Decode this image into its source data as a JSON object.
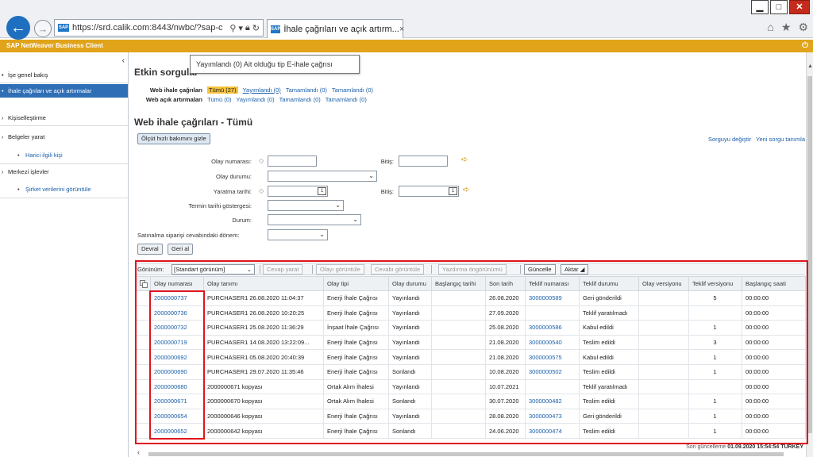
{
  "browser": {
    "url": "https://srd.calik.com:8443/nwbc/?sap-c",
    "tab_title": "İhale çağrıları ve açık artırm...",
    "tab_close": "×",
    "favicon_text": "SAP"
  },
  "sap_header": {
    "title": "SAP NetWeaver Business Client"
  },
  "sidebar": {
    "items": [
      {
        "label": "İşe genel bakış"
      },
      {
        "label": "İhale çağrıları ve açık artırmalar"
      },
      {
        "label": "Kişiselleştirme"
      },
      {
        "label": "Belgeler yarat"
      },
      {
        "label": "Harici ilgili kişi"
      },
      {
        "label": "Merkezi işlevler"
      },
      {
        "label": "Şirket verilerini görüntüle"
      }
    ]
  },
  "tooltip": "Yayımlandı (0) Ait olduğu tip E-ihale çağrısı",
  "queries": {
    "title": "Etkin sorgular",
    "web_ihale": {
      "label": "Web ihale çağrıları",
      "links": [
        "Tümü (27)",
        "Yayımlandı (0)",
        "Tamamlandı (0)",
        "Tamamlandı (0)"
      ]
    },
    "web_acik": {
      "label": "Web açık artırmaları",
      "links": [
        "Tümü (0)",
        "Yayımlandı (0)",
        "Tamamlandı (0)",
        "Tamamlandı (0)"
      ]
    }
  },
  "section": {
    "title": "Web ihale çağrıları - Tümü",
    "hide_criteria_button": "Ölçüt hızlı bakımını gizle",
    "change_query_link": "Sorguyu değiştir",
    "new_query_link": "Yeni sorgu tanımla"
  },
  "form": {
    "olay_numarasi": "Olay numarası:",
    "bitis1": "Bitiş:",
    "olay_durumu": "Olay durumu:",
    "yaratma_tarihi": "Yaratma tarihi:",
    "bitis2": "Bitiş:",
    "termin": "Termin tarihi göstergesi:",
    "durum": "Durum:",
    "satinalma": "Satınalma siparişi cevabındaki dönem:",
    "devral_button": "Devral",
    "geri_al_button": "Geri al"
  },
  "toolbar": {
    "view_label": "Görünüm:",
    "view_value": "[Standart görünüm]",
    "cevap_yarat": "Cevap yarat",
    "olayi_goruntule": "Olayı görüntüle",
    "cevabi_goruntule": "Cevabı görüntüle",
    "yazdirma": "Yazdırma öngörünümü",
    "guncelle": "Güncelle",
    "aktar": "Aktar"
  },
  "table": {
    "columns": [
      "Olay numarası",
      "Olay tanımı",
      "Olay tipi",
      "Olay durumu",
      "Başlangıç tarihi",
      "Son tarih",
      "Teklif numarası",
      "Teklif durumu",
      "Olay versiyonu",
      "Teklif versiyonu",
      "Başlangıç saati"
    ],
    "rows": [
      [
        "2000000737",
        "PURCHASER1 26.08.2020 11:04:37",
        "Enerji İhale Çağrısı",
        "Yayınlandı",
        "",
        "26.08.2020",
        "3000000589",
        "Geri gönderildi",
        "",
        "5",
        "00:00:00"
      ],
      [
        "2000000736",
        "PURCHASER1 26.08.2020 10:20:25",
        "Enerji İhale Çağrısı",
        "Yayınlandı",
        "",
        "27.09.2020",
        "",
        "Teklif yaratılmadı",
        "",
        "",
        "00:00:00"
      ],
      [
        "2000000732",
        "PURCHASER1 25.08.2020 11:36:29",
        "İnşaat İhale Çağrısı",
        "Yayınlandı",
        "",
        "25.08.2020",
        "3000000586",
        "Kabul edildi",
        "",
        "1",
        "00:00:00"
      ],
      [
        "2000000719",
        "PURCHASER1 14.08.2020 13:22:09...",
        "Enerji İhale Çağrısı",
        "Yayınlandı",
        "",
        "21.08.2020",
        "3000000540",
        "Teslim edildi",
        "",
        "3",
        "00:00:00"
      ],
      [
        "2000000692",
        "PURCHASER1 05.08.2020 20:40:39",
        "Enerji İhale Çağrısı",
        "Yayınlandı",
        "",
        "21.08.2020",
        "3000000575",
        "Kabul edildi",
        "",
        "1",
        "00:00:00"
      ],
      [
        "2000000690",
        "PURCHASER1 29.07.2020 11:35:46",
        "Enerji İhale Çağrısı",
        "Sonlandı",
        "",
        "10.08.2020",
        "3000000502",
        "Teslim edildi",
        "",
        "1",
        "00:00:00"
      ],
      [
        "2000000680",
        "2000000671 kopyası",
        "Ortak Alım İhalesi",
        "Yayınlandı",
        "",
        "10.07.2021",
        "",
        "Teklif yaratılmadı",
        "",
        "",
        "00:00:00"
      ],
      [
        "2000000671",
        "2000000670 kopyası",
        "Ortak Alım İhalesi",
        "Sonlandı",
        "",
        "30.07.2020",
        "3000000482",
        "Teslim edildi",
        "",
        "1",
        "00:00:00"
      ],
      [
        "2000000654",
        "2000000646 kopyası",
        "Enerji İhale Çağrısı",
        "Yayınlandı",
        "",
        "28.08.2020",
        "3000000473",
        "Geri gönderildi",
        "",
        "1",
        "00:00:00"
      ],
      [
        "2000000652",
        "2000000642 kopyası",
        "Enerji İhale Çağrısı",
        "Sonlandı",
        "",
        "24.06.2020",
        "3000000474",
        "Teslim edildi",
        "",
        "1",
        "00:00:00"
      ]
    ]
  },
  "footer": {
    "label": "Son güncelleme",
    "value": "01.09.2020 15:54:54 TÜRKEY"
  },
  "colors": {
    "sap_bar": "#e0a31a",
    "selected_nav": "#2f6fb6",
    "link": "#1b5fa8",
    "highlight_box": "#e0141c",
    "active_query": "#f6c23c"
  }
}
